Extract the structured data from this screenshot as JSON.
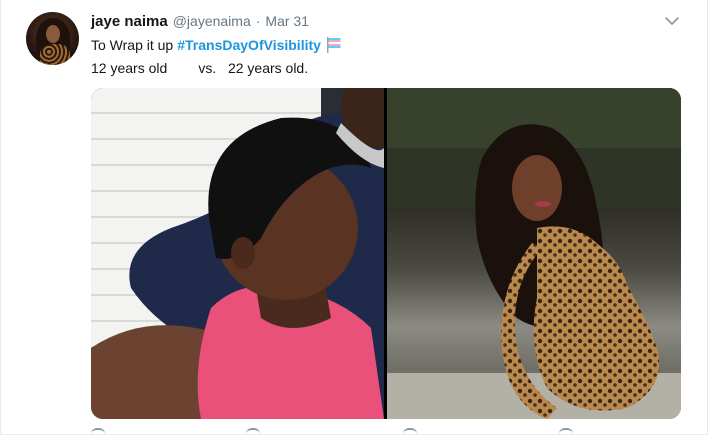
{
  "tweet": {
    "author_name": "jaye naima",
    "handle": "@jayenaima",
    "separator": "·",
    "date": "Mar 31",
    "text_prefix": "To Wrap it up",
    "hashtag": "#TransDayOfVisibility",
    "text_line2": "12 years old        vs.   22 years old."
  },
  "icons": {
    "menu": "chevron-down-icon",
    "emoji": "transgender-flag-icon",
    "reply": "reply-icon",
    "retweet": "retweet-icon",
    "like": "heart-icon",
    "share": "share-icon"
  },
  "colors": {
    "link": "#1b95e0",
    "secondary_text": "#657786",
    "primary_text": "#14171a",
    "flag_blue": "#5bcefa",
    "flag_pink": "#f5a9b8"
  }
}
